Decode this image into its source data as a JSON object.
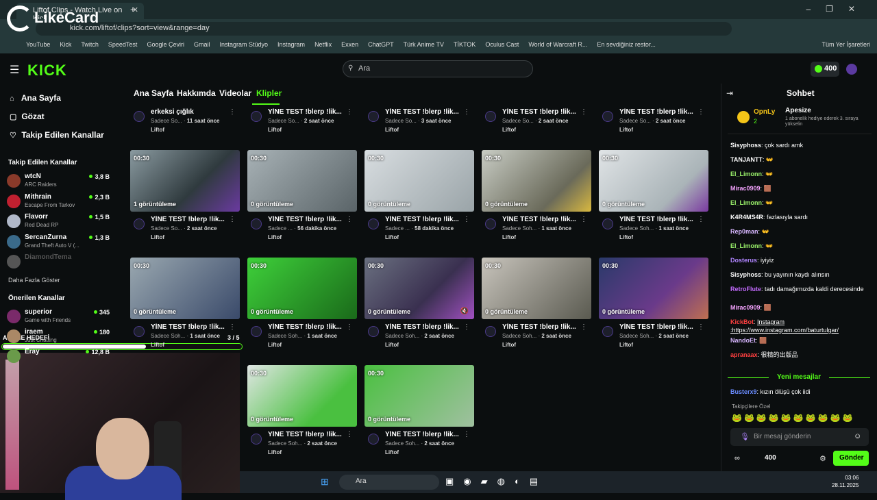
{
  "browser": {
    "tab_title": "Liftof Clips - Watch Live on Kick",
    "url": "kick.com/liftof/clips?sort=view&range=day",
    "overlay_logo": "LikeCard",
    "bookmarks": [
      "YouTube",
      "Kick",
      "Twitch",
      "SpeedTest",
      "Google Çeviri",
      "Gmail",
      "Instagram Stüdyo",
      "Instagram",
      "Netflix",
      "Exxen",
      "ChatGPT",
      "Türk Anime TV",
      "TİKTOK",
      "Oculus Cast",
      "World of Warcraft R...",
      "En sevdiğiniz restor..."
    ],
    "bookmarks_folder": "Tüm Yer İşaretleri"
  },
  "header": {
    "logo": "KICK",
    "search_placeholder": "Ara",
    "coins": "400"
  },
  "sidebar": {
    "nav": [
      "Ana Sayfa",
      "Gözat",
      "Takip Edilen Kanallar"
    ],
    "followed_title": "Takip Edilen Kanallar",
    "followed": [
      {
        "name": "wtcN",
        "game": "ARC Raiders",
        "viewers": "3,8 B"
      },
      {
        "name": "Mithrain",
        "game": "Escape From Tarkov",
        "viewers": "2,3 B"
      },
      {
        "name": "Flavorr",
        "game": "Red Dead RP",
        "viewers": "1,5 B"
      },
      {
        "name": "SercanZurna",
        "game": "Grand Theft Auto V (...",
        "viewers": "1,3 B"
      },
      {
        "name": "DiamondTema",
        "game": "",
        "viewers": ""
      }
    ],
    "more": "Daha Fazla Göster",
    "recommended_title": "Önerilen Kanallar",
    "recommended": [
      {
        "name": "superior",
        "game": "Game with Friends",
        "viewers": "345"
      },
      {
        "name": "iraem",
        "game": "Just Chatting",
        "viewers": "180"
      },
      {
        "name": "Eray",
        "game": "",
        "viewers": "12,8 B"
      }
    ]
  },
  "tabs": [
    "Ana Sayfa",
    "Hakkımda",
    "Videolar",
    "Klipler"
  ],
  "top_row": [
    {
      "title": "erkeksi çığlık",
      "sub": "Sadece So...",
      "age": "11 saat önce",
      "channel": "Liftof"
    },
    {
      "title": "YİNE TEST !blerp !lik...",
      "sub": "Sadece So...",
      "age": "2 saat önce",
      "channel": "Liftof"
    },
    {
      "title": "YİNE TEST !blerp !lik...",
      "sub": "Sadece So...",
      "age": "3 saat önce",
      "channel": "Liftof"
    },
    {
      "title": "YİNE TEST !blerp !lik...",
      "sub": "Sadece So...",
      "age": "2 saat önce",
      "channel": "Liftof"
    },
    {
      "title": "YİNE TEST !blerp !lik...",
      "sub": "Sadece So...",
      "age": "2 saat önce",
      "channel": "Liftof"
    }
  ],
  "clips": [
    {
      "duration": "00:30",
      "views": "1 görüntüleme",
      "title": "YİNE TEST !blerp !lik...",
      "sub": "Sadece So...",
      "age": "2 saat önce",
      "channel": "Liftof"
    },
    {
      "duration": "00:30",
      "views": "0 görüntüleme",
      "title": "YİNE TEST !blerp !lik...",
      "sub": "Sadece ...",
      "age": "56 dakika önce",
      "channel": "Liftof"
    },
    {
      "duration": "00:30",
      "views": "0 görüntüleme",
      "title": "YİNE TEST !blerp !lik...",
      "sub": "Sadece ...",
      "age": "58 dakika önce",
      "channel": "Liftof"
    },
    {
      "duration": "00:30",
      "views": "0 görüntüleme",
      "title": "YİNE TEST !blerp !lik...",
      "sub": "Sadece Soh...",
      "age": "1 saat önce",
      "channel": "Liftof"
    },
    {
      "duration": "00:30",
      "views": "0 görüntüleme",
      "title": "YİNE TEST !blerp !lik...",
      "sub": "Sadece Soh...",
      "age": "1 saat önce",
      "channel": "Liftof"
    },
    {
      "duration": "00:30",
      "views": "0 görüntüleme",
      "title": "YİNE TEST !blerp !lik...",
      "sub": "Sadece Soh...",
      "age": "1 saat önce",
      "channel": "Liftof"
    },
    {
      "duration": "00:30",
      "views": "0 görüntüleme",
      "title": "YİNE TEST !blerp !lik...",
      "sub": "Sadece Soh...",
      "age": "1 saat önce",
      "channel": "Liftof"
    },
    {
      "duration": "00:30",
      "views": "0 görüntüleme",
      "title": "YİNE TEST !blerp !lik...",
      "sub": "Sadece Soh...",
      "age": "2 saat önce",
      "channel": "Liftof"
    },
    {
      "duration": "00:30",
      "views": "0 görüntüleme",
      "title": "YİNE TEST !blerp !lik...",
      "sub": "Sadece Soh...",
      "age": "2 saat önce",
      "channel": "Liftof"
    },
    {
      "duration": "00:30",
      "views": "0 görüntüleme",
      "title": "YİNE TEST !blerp !lik...",
      "sub": "Sadece Soh...",
      "age": "2 saat önce",
      "channel": "Liftof"
    },
    {
      "duration": "00:30",
      "views": "0 görüntüleme",
      "title": "YİNE TEST !blerp !lik...",
      "sub": "Sadece Soh...",
      "age": "2 saat önce",
      "channel": "Liftof"
    },
    {
      "duration": "00:30",
      "views": "0 görüntüleme",
      "title": "YİNE TEST !blerp !lik...",
      "sub": "Sadece Soh...",
      "age": "2 saat önce",
      "channel": "Liftof"
    }
  ],
  "chat": {
    "title": "Sohbet",
    "pinned_user": "OpnLy",
    "pinned_count": "2",
    "pinned_name": "Apesize",
    "pinned_text": "1 abonelik hediye ederek 3. sıraya yükselin",
    "messages": [
      {
        "user": "Sisyphoss",
        "text": "çok sardı amk",
        "color": "#ffffff"
      },
      {
        "user": "TANJANTT",
        "text": "👐",
        "color": "#ffffff"
      },
      {
        "user": "El_Limonn",
        "text": "👐",
        "color": "#9bf26b"
      },
      {
        "user": "Mirac0909",
        "text": "🟫",
        "color": "#f5a3ff"
      },
      {
        "user": "El_Limonn",
        "text": "👐",
        "color": "#9bf26b"
      },
      {
        "user": "K4R4MS4R",
        "text": "fazlasıyla sardı",
        "color": "#ffffff"
      },
      {
        "user": "Rep0man",
        "text": "👐",
        "color": "#d7b6ff"
      },
      {
        "user": "El_Limonn",
        "text": "👐",
        "color": "#9bf26b"
      },
      {
        "user": "Dosterus",
        "text": "iyiyiz",
        "color": "#b085ff"
      },
      {
        "user": "Sisyphoss",
        "text": "bu yayının kaydı alınsın",
        "color": "#ffffff"
      },
      {
        "user": "RetroFlute",
        "text": "tadı damağımızda kaldi derecesinde",
        "color": "#c46bff"
      },
      {
        "user": "Mirac0909",
        "text": "🟫",
        "color": "#f5a3ff"
      },
      {
        "user": "KickBot",
        "text": "Instagram :https://www.instagram.com/baturtulgar/",
        "color": "#ff4040"
      },
      {
        "user": "NandoEt",
        "text": "🟫",
        "color": "#d7b6ff"
      },
      {
        "user": "apranaax",
        "text": "很精的出版品",
        "color": "#ff4040"
      }
    ],
    "new_messages": "Yeni mesajlar",
    "last_message": {
      "user": "Busterx9",
      "text": "kızın ölüşü çok iidi",
      "color": "#6a8cff"
    },
    "emote_label": "Takipçilere Özel",
    "input_placeholder": "Bir mesaj gönderin",
    "coins": "400",
    "send": "Gönder"
  },
  "stream_overlay": {
    "goal_label": "ABONE HEDEFİ",
    "goal_progress": "3 / 5",
    "goal_fraction": 0.6
  },
  "taskbar": {
    "search": "Ara",
    "time": "03:06",
    "date": "28.11.2025"
  }
}
